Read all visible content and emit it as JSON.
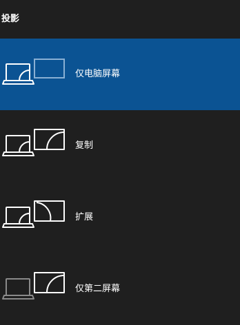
{
  "panel": {
    "title": "投影"
  },
  "options": [
    {
      "label": "仅电脑屏幕",
      "icon": "pc-screen-only-icon",
      "selected": true
    },
    {
      "label": "复制",
      "icon": "duplicate-icon",
      "selected": false
    },
    {
      "label": "扩展",
      "icon": "extend-icon",
      "selected": false
    },
    {
      "label": "仅第二屏幕",
      "icon": "second-screen-only-icon",
      "selected": false
    }
  ],
  "colors": {
    "background": "#1f1f1f",
    "selected_background": "#0b5393",
    "icon_active": "#ffffff",
    "icon_dimmed": "#8a8a8a",
    "text": "#ffffff"
  }
}
